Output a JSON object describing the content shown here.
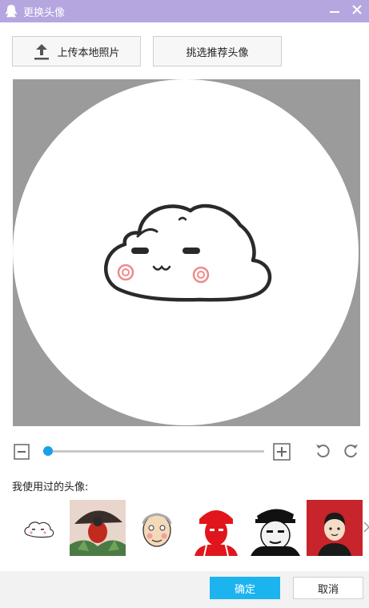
{
  "window": {
    "title": "更换头像",
    "title_bar_color": "#b5a6e0",
    "logo_icon": "qq-penguin-icon",
    "minimize_icon": "minimize-icon",
    "close_icon": "close-icon"
  },
  "toolbar": {
    "upload_label": "上传本地照片",
    "upload_icon": "upload-arrow-icon",
    "choose_label": "挑选推荐头像"
  },
  "editor": {
    "preview_image": "cute-cloud-avatar",
    "zoom_out_icon": "zoom-out-icon",
    "zoom_in_icon": "zoom-in-icon",
    "rotate_left_icon": "rotate-left-icon",
    "rotate_right_icon": "rotate-right-icon",
    "zoom_level_fraction": 0.02,
    "accent_color": "#1aa0e8"
  },
  "recent": {
    "label": "我使用过的头像:",
    "avatars": [
      {
        "name": "cloud-face"
      },
      {
        "name": "red-figure-umbrella"
      },
      {
        "name": "elderly-man-cartoon"
      },
      {
        "name": "red-stencil-soldier"
      },
      {
        "name": "cap-wearing-man-meme"
      },
      {
        "name": "cartoon-man-red-background"
      }
    ],
    "next_icon": "chevron-right-icon"
  },
  "footer": {
    "ok_label": "确定",
    "cancel_label": "取消",
    "ok_color": "#1cb4ef"
  }
}
